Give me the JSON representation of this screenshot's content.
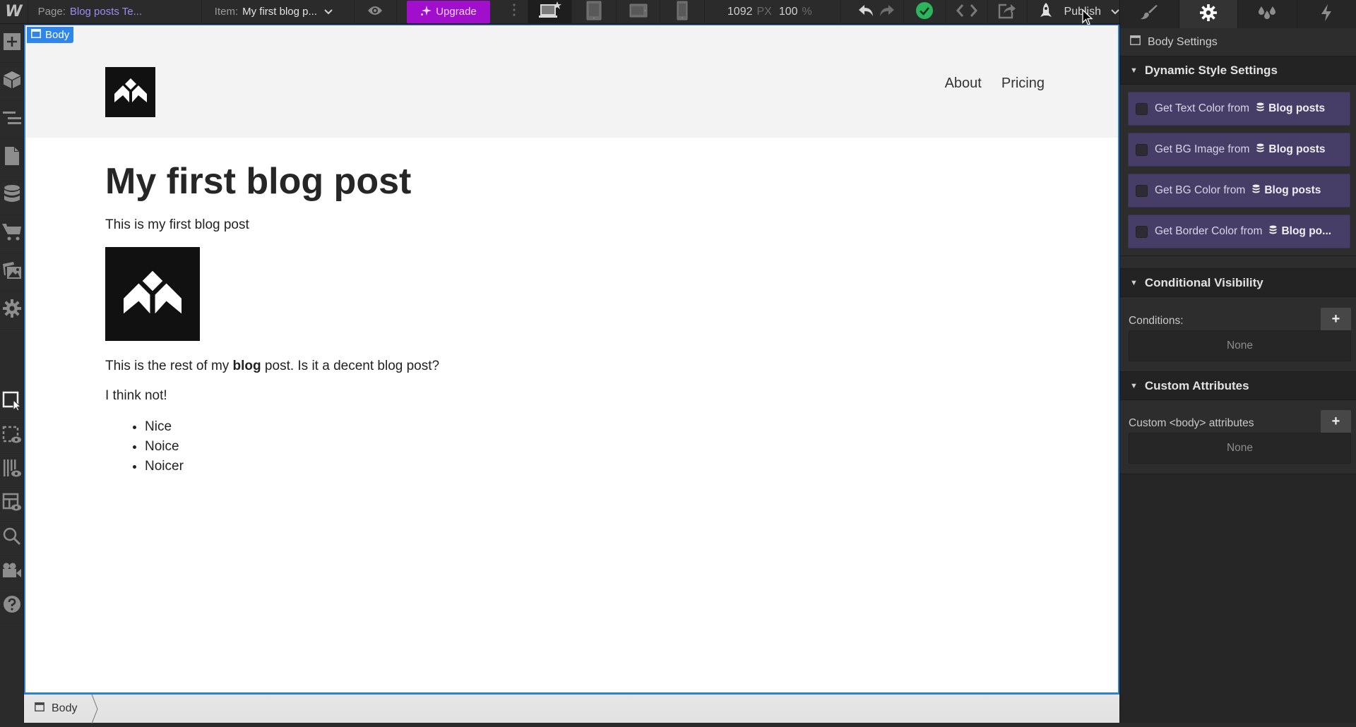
{
  "app": {
    "logo": "W"
  },
  "topbar": {
    "page_label": "Page:",
    "page_value": "Blog posts Te...",
    "item_label": "Item:",
    "item_value": "My first blog p...",
    "upgrade_label": "Upgrade",
    "canvas_width": "1092",
    "canvas_width_unit": "PX",
    "zoom": "100",
    "zoom_unit": "%",
    "publish_label": "Publish",
    "breakpoints": [
      "desktop-base",
      "tablet",
      "mobile-landscape",
      "mobile-portrait"
    ],
    "active_breakpoint": "desktop-base"
  },
  "right_panel": {
    "tabs": [
      "style-brush",
      "settings-gear",
      "interactions-drops",
      "lightning"
    ],
    "active_tab": "settings-gear",
    "header": "Body Settings",
    "dynamic_style": {
      "title": "Dynamic Style Settings",
      "items": [
        {
          "label": "Get Text Color from",
          "source": "Blog posts",
          "checked": false
        },
        {
          "label": "Get BG Image from",
          "source": "Blog posts",
          "checked": false
        },
        {
          "label": "Get BG Color from",
          "source": "Blog posts",
          "checked": false
        },
        {
          "label": "Get Border Color from",
          "source": "Blog po...",
          "checked": false
        }
      ]
    },
    "conditional_visibility": {
      "title": "Conditional Visibility",
      "conditions_label": "Conditions:",
      "empty": "None"
    },
    "custom_attributes": {
      "title": "Custom Attributes",
      "label": "Custom <body> attributes",
      "empty": "None"
    }
  },
  "left_rail": {
    "top": [
      "add",
      "components",
      "navigator",
      "pages",
      "cms",
      "ecommerce",
      "assets",
      "settings"
    ],
    "bottom": [
      "select-element",
      "preview-edges",
      "xray",
      "guides-preview",
      "search",
      "video-tutorials",
      "help"
    ]
  },
  "canvas": {
    "selected_tag": "Body",
    "nav": {
      "links": [
        "About",
        "Pricing"
      ]
    },
    "post": {
      "title": "My first blog post",
      "intro": "This is my first blog post",
      "body_before_bold": "This is the rest of my ",
      "body_bold": "blog",
      "body_after_bold": " post. Is it a decent blog post?",
      "second_paragraph": "I think not!",
      "list": [
        "Nice",
        "Noice",
        "Noicer"
      ]
    }
  },
  "breadcrumb": {
    "items": [
      "Body"
    ]
  },
  "colors": {
    "accent_blue": "#2f86e8",
    "upgrade_purple": "#a10fcc",
    "page_link": "#9d8cf0",
    "dynamic_item_bg": "#463e66",
    "publish_ok_green": "#2db55d"
  }
}
